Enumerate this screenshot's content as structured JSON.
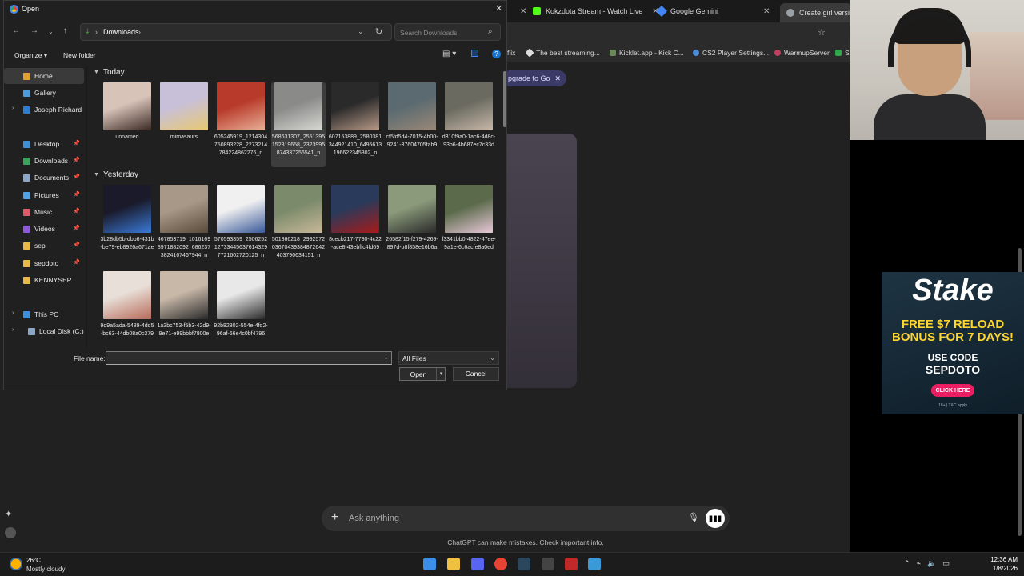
{
  "browser": {
    "tabs": [
      {
        "label": "Kokzdota Stream - Watch Live",
        "color": "#53fc18"
      },
      {
        "label": "Google Gemini",
        "color": "#4285f4"
      },
      {
        "label": "Create girl version",
        "color": "#9aa0a6"
      }
    ],
    "bookmarks": [
      {
        "label": "flix"
      },
      {
        "label": "The best streaming..."
      },
      {
        "label": "Kicklet.app - Kick C..."
      },
      {
        "label": "CS2 Player Settings..."
      },
      {
        "label": "WarmupServer"
      },
      {
        "label": "S"
      }
    ]
  },
  "chatgpt": {
    "upgrade_label": "pgrade to Go",
    "input_placeholder": "Ask anything",
    "disclaimer": "ChatGPT can make mistakes. Check important info."
  },
  "ad": {
    "logo": "Stake",
    "line1": "FREE $7 RELOAD",
    "line1b": "BONUS FOR 7 DAYS!",
    "code_label": "USE CODE",
    "code": "SEPDOTO",
    "button": "CLICK HERE",
    "fine_print": "18+ | T&C apply"
  },
  "dialog": {
    "title": "Open",
    "path": [
      "Downloads"
    ],
    "search_placeholder": "Search Downloads",
    "organize_label": "Organize",
    "new_folder_label": "New folder",
    "nav_pane": [
      {
        "label": "Home",
        "icon": "home-icon",
        "color": "#e0a030",
        "selected": true,
        "pinned": false,
        "expander": false
      },
      {
        "label": "Gallery",
        "icon": "gallery-icon",
        "color": "#4a9be0",
        "selected": false,
        "pinned": false,
        "expander": false
      },
      {
        "label": "Joseph Richard",
        "icon": "cloud-icon",
        "color": "#2e7dd1",
        "selected": false,
        "pinned": false,
        "expander": true
      },
      {
        "label": "Desktop",
        "icon": "desktop-icon",
        "color": "#3c8fd8",
        "selected": false,
        "pinned": true,
        "expander": false
      },
      {
        "label": "Downloads",
        "icon": "download-icon",
        "color": "#3aa55a",
        "selected": false,
        "pinned": true,
        "expander": false
      },
      {
        "label": "Documents",
        "icon": "documents-icon",
        "color": "#8aa7c8",
        "selected": false,
        "pinned": true,
        "expander": false
      },
      {
        "label": "Pictures",
        "icon": "pictures-icon",
        "color": "#4fa2e8",
        "selected": false,
        "pinned": true,
        "expander": false
      },
      {
        "label": "Music",
        "icon": "music-icon",
        "color": "#e05a6a",
        "selected": false,
        "pinned": true,
        "expander": false
      },
      {
        "label": "Videos",
        "icon": "videos-icon",
        "color": "#8c5ad8",
        "selected": false,
        "pinned": true,
        "expander": false
      },
      {
        "label": "sep",
        "icon": "folder-icon",
        "color": "#e8b84a",
        "selected": false,
        "pinned": true,
        "expander": false
      },
      {
        "label": "sepdoto",
        "icon": "folder-icon",
        "color": "#e8b84a",
        "selected": false,
        "pinned": true,
        "expander": false
      },
      {
        "label": "KENNYSEP",
        "icon": "folder-icon",
        "color": "#e8b84a",
        "selected": false,
        "pinned": false,
        "expander": false
      },
      {
        "label": "This PC",
        "icon": "pc-icon",
        "color": "#3c8fd8",
        "selected": false,
        "pinned": false,
        "expander": true
      },
      {
        "label": "Local Disk (C:)",
        "icon": "disk-icon",
        "color": "#8aa7c8",
        "selected": false,
        "pinned": false,
        "expander": true
      }
    ],
    "groups": [
      {
        "label": "Today",
        "files": [
          {
            "name": "unnamed",
            "colors": [
              "#d8c3b8",
              "#3a2a24"
            ]
          },
          {
            "name": "mimasaurs",
            "colors": [
              "#c8c0d8",
              "#e8c870"
            ]
          },
          {
            "name": "605245919_1214304750893228_2273214784224862276_n",
            "colors": [
              "#b83a2a",
              "#e8b098"
            ]
          },
          {
            "name": "568631307_2551395152819658_2323995874337256541_n",
            "colors": [
              "#8a8a88",
              "#d8d8d4"
            ],
            "selected": true
          },
          {
            "name": "607153889_2580381344921410_6495613196622345302_n",
            "colors": [
              "#2a2a2a",
              "#b89a88"
            ]
          },
          {
            "name": "cf5fd5d4-7015-4b00-9241-37604705fab9",
            "colors": [
              "#5a6a70",
              "#9a8878"
            ]
          },
          {
            "name": "d310f9a0-1ac6-4d8c-93b6-4b687ec7c33d",
            "colors": [
              "#6a6a60",
              "#c8b8a8"
            ]
          }
        ]
      },
      {
        "label": "Yesterday",
        "files": [
          {
            "name": "3b28db5b-dbb6-431b-be79-eb8926a671ae",
            "colors": [
              "#1a1a2a",
              "#3a7ad8"
            ]
          },
          {
            "name": "467853719_10161698971882092_6862373824167467944_n",
            "colors": [
              "#a89888",
              "#5a4a3a"
            ]
          },
          {
            "name": "570593859_2506252127334456376143297721602720125_n",
            "colors": [
              "#f0f0f0",
              "#3a5a9a"
            ]
          },
          {
            "name": "501366218_299257203670439384872642403790634151_n",
            "colors": [
              "#7a8a6a",
              "#c8b898"
            ]
          },
          {
            "name": "8cecb217-7780-4c22-ace8-43ebffc4fd69",
            "colors": [
              "#2a3a5a",
              "#a81a1a"
            ]
          },
          {
            "name": "26582f15-f279-4269-897d-b8f858e16b6a",
            "colors": [
              "#8a9a7a",
              "#2a2a2a"
            ]
          },
          {
            "name": "f3341bb0-4822-47ee-9a1e-6c6acfe8a0ed",
            "colors": [
              "#5a6a4a",
              "#e8c8d8"
            ]
          },
          {
            "name": "9d9a5ada-5489-4dd5-bc63-44db08a0c379",
            "colors": [
              "#e8e0d8",
              "#b86a5a"
            ]
          },
          {
            "name": "1a3bc753-f5b3-42d9-9e71-e99bbbf7800e",
            "colors": [
              "#c8b8a8",
              "#2a2a2a"
            ]
          },
          {
            "name": "92b82802-554e-4fd2-96af-66e4c0bf4796",
            "colors": [
              "#e8e8e8",
              "#2a2a2a"
            ]
          }
        ]
      }
    ],
    "file_name_label": "File name:",
    "file_name_value": "",
    "filter_value": "All Files",
    "open_label": "Open",
    "cancel_label": "Cancel"
  },
  "taskbar": {
    "temperature": "26°C",
    "weather": "Mostly cloudy",
    "time": "12:36 AM",
    "date": "1/8/2026",
    "apps": [
      {
        "name": "windows-start-icon",
        "color": "#3c8fe8"
      },
      {
        "name": "file-explorer-icon",
        "color": "#f0c040"
      },
      {
        "name": "discord-icon",
        "color": "#5865f2"
      },
      {
        "name": "chrome-icon",
        "color": "#ea4335"
      },
      {
        "name": "steam-icon",
        "color": "#2a475e"
      },
      {
        "name": "obs-icon",
        "color": "#444444"
      },
      {
        "name": "app-red-icon",
        "color": "#c0282a"
      },
      {
        "name": "notepad-icon",
        "color": "#3a9ad8"
      }
    ]
  }
}
